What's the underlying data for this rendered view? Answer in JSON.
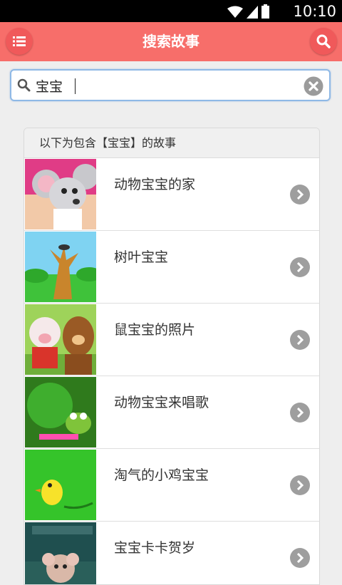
{
  "status_bar": {
    "time": "10:10"
  },
  "app_bar": {
    "title": "搜索故事",
    "menu_icon": "menu-icon",
    "search_icon": "search-icon"
  },
  "search": {
    "value": "宝宝",
    "clear_icon": "clear-icon"
  },
  "results": {
    "header": "以下为包含【宝宝】的故事",
    "items": [
      {
        "title": "动物宝宝的家"
      },
      {
        "title": "树叶宝宝"
      },
      {
        "title": "鼠宝宝的照片"
      },
      {
        "title": "动物宝宝来唱歌"
      },
      {
        "title": "淘气的小鸡宝宝"
      },
      {
        "title": "宝宝卡卡贺岁"
      }
    ]
  },
  "colors": {
    "accent": "#f76e6a",
    "status_bar": "#000000"
  }
}
